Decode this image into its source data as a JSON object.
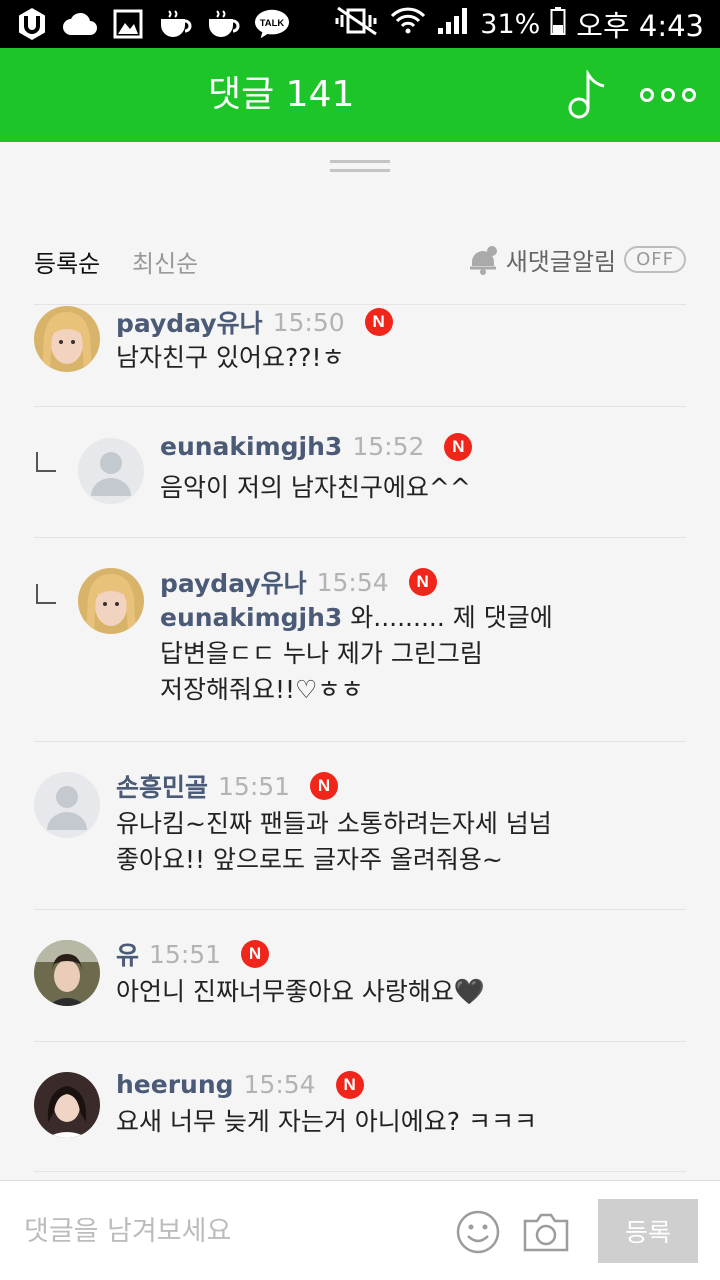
{
  "status_bar": {
    "icons": [
      "u-plus-icon",
      "cloud-icon",
      "gallery-icon",
      "coffee-icon",
      "coffee-icon",
      "kakaotalk-icon"
    ],
    "talk_label": "TALK",
    "battery": "31%",
    "time": "오후 4:43"
  },
  "header": {
    "title": "댓글 141"
  },
  "sort": {
    "tabs": [
      "등록순",
      "최신순"
    ],
    "notify_label": "새댓글알림",
    "notify_state": "OFF"
  },
  "comments": [
    {
      "author": "payday유나",
      "time": "15:50",
      "badge": "N",
      "reply": false,
      "avatar": "photo",
      "body": "남자친구 있어요??!ㅎ"
    },
    {
      "author": "eunakimgjh3",
      "time": "15:52",
      "badge": "N",
      "reply": true,
      "avatar": "default",
      "body": "음악이 저의 남자친구에요^^"
    },
    {
      "author": "payday유나",
      "time": "15:54",
      "badge": "N",
      "reply": true,
      "avatar": "photo",
      "mention": "eunakimgjh3",
      "body": " 와......... 제 댓글에\n답변을ㄷㄷ 누나 제가 그린그림\n저장해줘요!!♡ㅎㅎ"
    },
    {
      "author": "손흥민골",
      "time": "15:51",
      "badge": "N",
      "reply": false,
      "avatar": "default",
      "body": "유나킴~진짜 팬들과 소통하려는자세 넘넘\n좋아요!! 앞으로도 글자주 올려줘용~"
    },
    {
      "author": "유",
      "time": "15:51",
      "badge": "N",
      "reply": false,
      "avatar": "photo",
      "body": "아언니 진짜너무좋아요 사랑해요",
      "heart": "🖤"
    },
    {
      "author": "heerung",
      "time": "15:54",
      "badge": "N",
      "reply": false,
      "avatar": "photo",
      "body": "요새 너무 늦게 자는거 아니에요? ㅋㅋㅋ"
    }
  ],
  "input_bar": {
    "placeholder": "댓글을 남겨보세요",
    "submit_label": "등록"
  },
  "colors": {
    "header_green": "#1ec529",
    "author_blue": "#4b5a76",
    "badge_red": "#f1261b"
  }
}
